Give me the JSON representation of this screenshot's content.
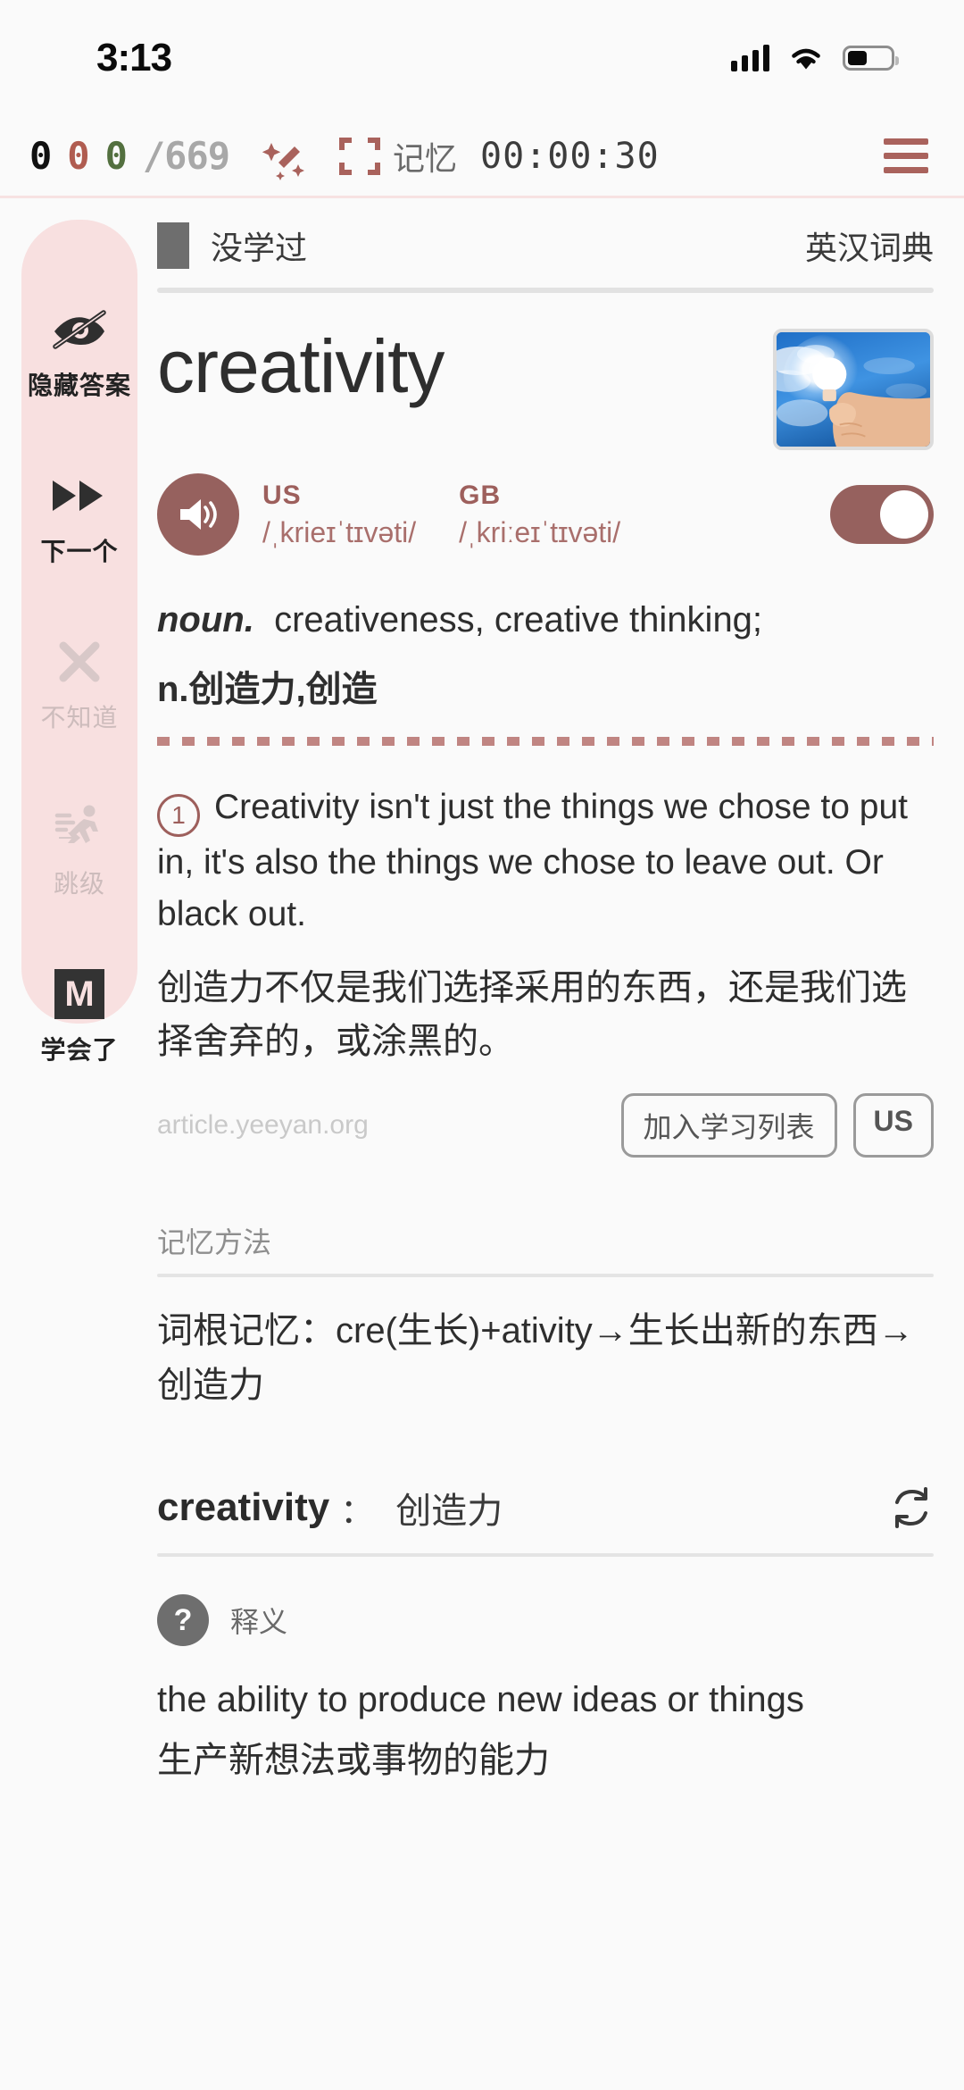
{
  "status_bar": {
    "time": "3:13",
    "signal_icon": "cellular-bars-icon",
    "wifi_icon": "wifi-icon",
    "battery_icon": "battery-icon"
  },
  "toolbar": {
    "count_black": "0",
    "count_red": "0",
    "count_green": "0",
    "count_total": "/669",
    "magic_icon": "magic-wand-icon",
    "fullscreen_icon": "fullscreen-icon",
    "mode_label": "记忆",
    "timer": "00:00:30",
    "menu_icon": "hamburger-menu-icon",
    "accent_color": "#a9625c"
  },
  "sidebar": {
    "items": [
      {
        "label": "隐藏答案",
        "icon": "eye-off-icon",
        "state": "active"
      },
      {
        "label": "下一个",
        "icon": "fast-forward-icon",
        "state": "active"
      },
      {
        "label": "不知道",
        "icon": "close-x-icon",
        "state": "dim"
      },
      {
        "label": "跳级",
        "icon": "running-person-icon",
        "state": "dim"
      },
      {
        "label": "学会了",
        "icon": "mastered-m-icon",
        "state": "active"
      }
    ],
    "background_color": "#f8e0e0"
  },
  "card": {
    "learn_status": "没学过",
    "dictionary": "英汉词典",
    "word": "creativity",
    "image_alt": "hand-holding-glowing-lightbulb-against-blue-sky",
    "speaker_icon": "speaker-volume-icon",
    "pronunciations": [
      {
        "region": "US",
        "ipa": "/ˌkrieɪˈtɪvəti/"
      },
      {
        "region": "GB",
        "ipa": "/ˌkriːeɪˈtɪvəti/"
      }
    ],
    "autoplay_toggle": "on",
    "definition_pos": "noun.",
    "definition_en": "creativeness, creative thinking;",
    "definition_cn": "n.创造力,创造"
  },
  "example": {
    "number": "1",
    "text_en": "Creativity isn't just the things we chose to put in, it's also the things we chose to leave out. Or black out.",
    "text_cn": "创造力不仅是我们选择采用的东西，还是我们选择舍弃的，或涂黑的。",
    "source": "article.yeeyan.org",
    "add_button": "加入学习列表",
    "accent_button": "US"
  },
  "mnemonic": {
    "heading": "记忆方法",
    "body": "词根记忆：cre(生长)+ativity→生长出新的东西→创造力"
  },
  "translation": {
    "word": "creativity",
    "separator": "：",
    "meaning": "创造力",
    "refresh_icon": "refresh-icon"
  },
  "explanation": {
    "help_icon": "question-mark-icon",
    "label": "释义",
    "text_en": "the ability to produce new ideas or things",
    "text_cn": "生产新想法或事物的能力"
  }
}
